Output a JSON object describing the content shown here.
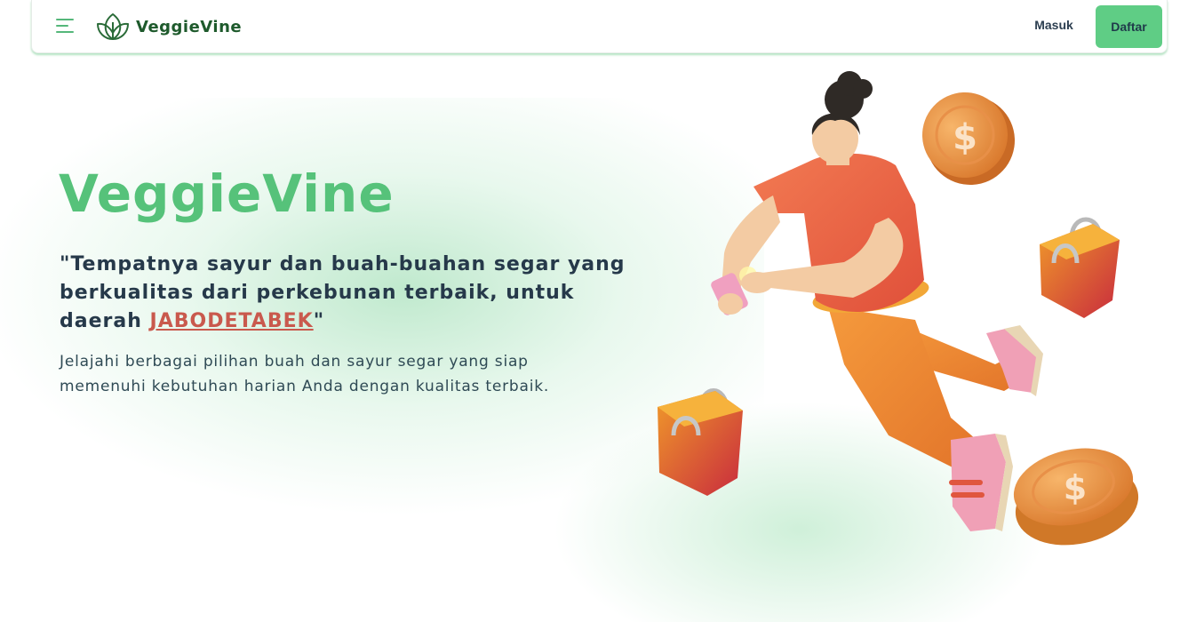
{
  "navbar": {
    "brand": "VeggieVine",
    "login_label": "Masuk",
    "register_label": "Daftar",
    "menu_icon": "hamburger-menu-icon",
    "logo_icon": "leaf-logo-icon"
  },
  "hero": {
    "title": "VeggieVine",
    "tagline_before": "\"Tempatnya sayur dan buah-buahan segar yang berkualitas dari perkebunan terbaik, untuk daerah ",
    "tagline_highlight": "JABODETABEK",
    "tagline_after": "\"",
    "description": "Jelajahi berbagai pilihan buah dan sayur segar yang siap memenuhi kebutuhan harian Anda dengan kualitas terbaik.",
    "coin_symbol": "$"
  },
  "colors": {
    "accent": "#5fcd85",
    "title": "#56c27a",
    "brand": "#1e5a2c",
    "highlight": "#c9594d",
    "text": "#26394a"
  }
}
